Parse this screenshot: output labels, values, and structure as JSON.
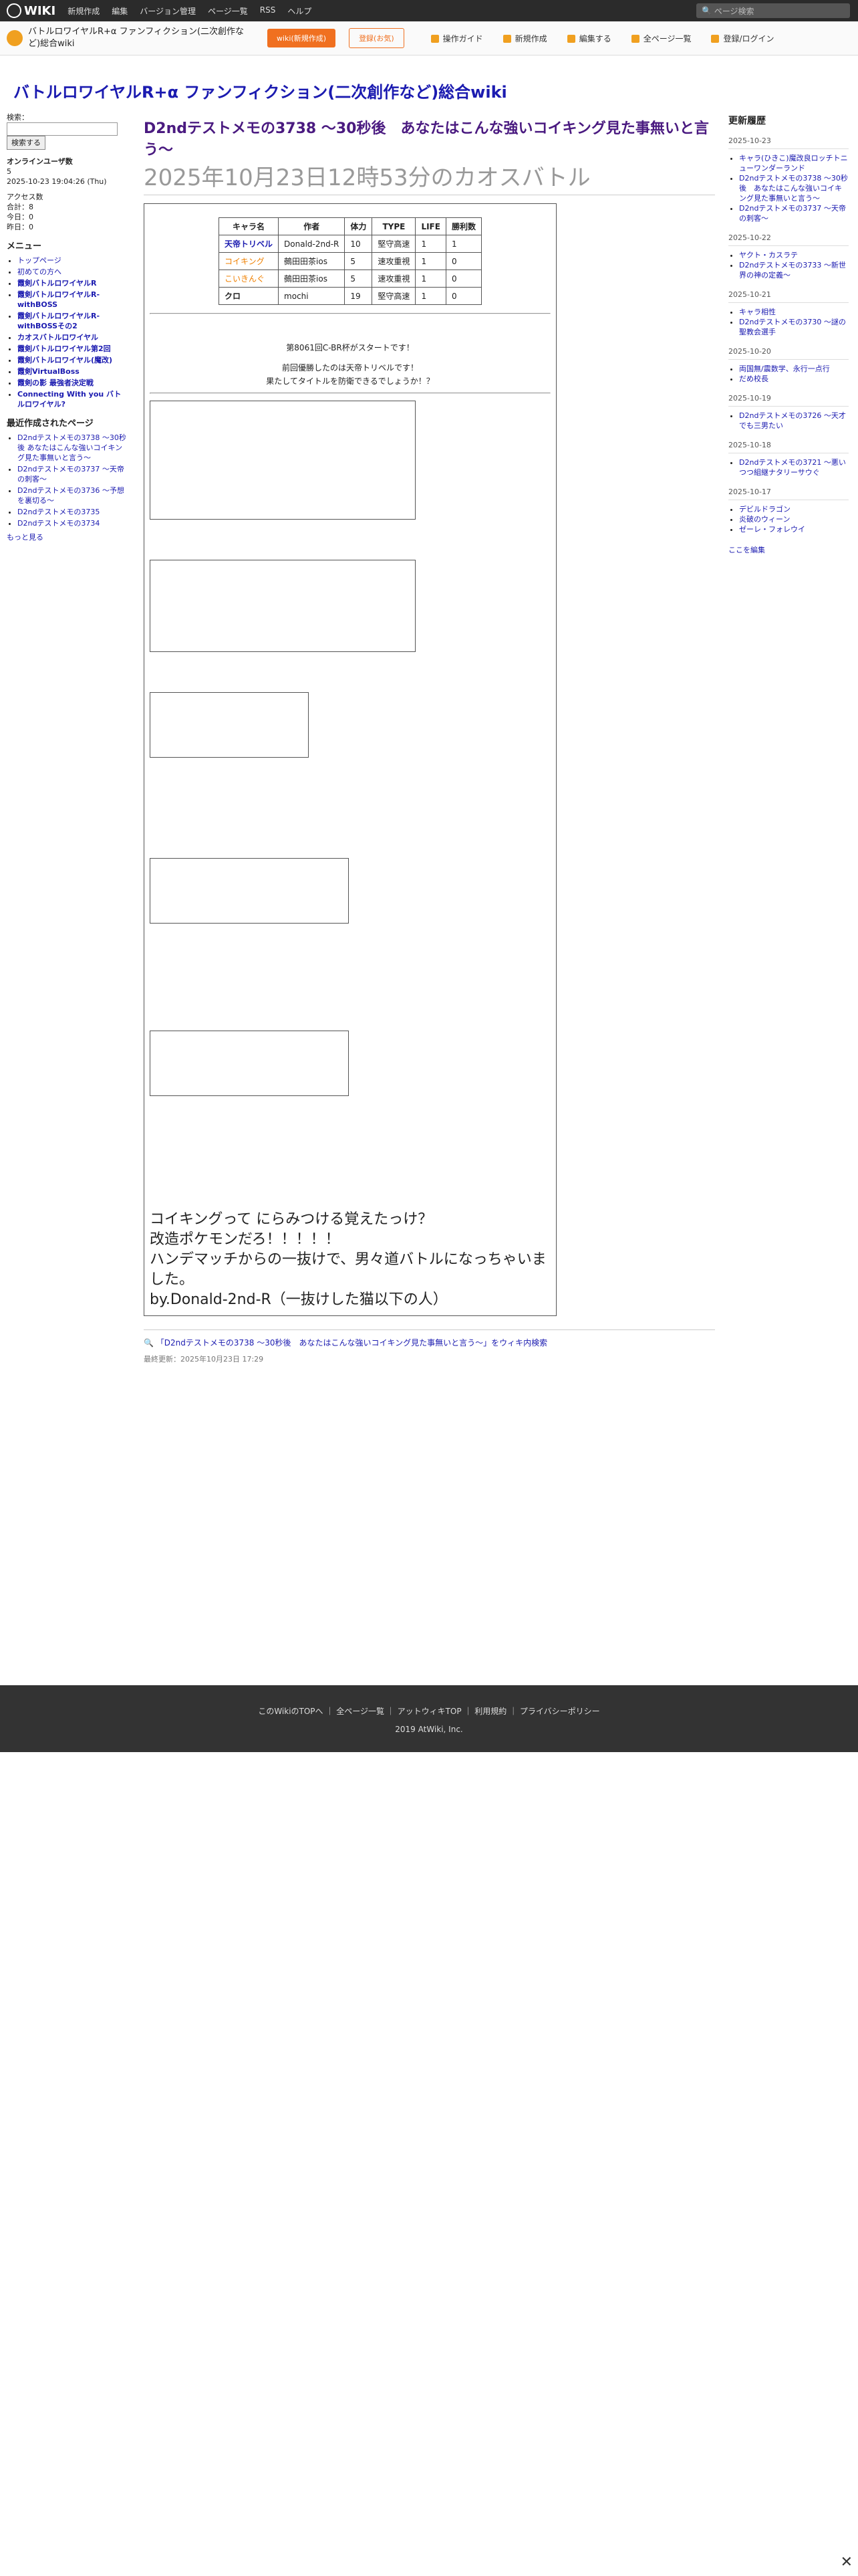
{
  "topbar": {
    "logo": "WIKI",
    "menu": [
      "新規作成",
      "編集",
      "バージョン管理",
      "ページ一覧",
      "RSS",
      "ヘルプ"
    ],
    "search_placeholder": "ページ検索"
  },
  "header": {
    "site_name": "バトルロワイヤルR+α ファンフィクション(二次創作など)総合wiki",
    "btn_wiki": "wiki(新規作成)",
    "btn_register": "登録(お気)",
    "nav": [
      "操作ガイド",
      "新規作成",
      "編集する",
      "全ページ一覧",
      "登録/ログイン"
    ]
  },
  "site_title": "バトルロワイヤルR+α ファンフィクション(二次創作など)総合wiki",
  "sidebar": {
    "search_label": "検索：",
    "search_btn": "検索する",
    "online_title": "オンラインユーザ数",
    "online_count": "5",
    "date": "2025-10-23 19:04:26 (Thu)",
    "access_title": "アクセス数",
    "access_total": "合計：8",
    "access_today": "今日：0",
    "access_yesterday": "昨日：0",
    "menu_title": "メニュー",
    "menu_items": [
      "トップページ",
      "初めての方へ",
      "霞剣バトルロワイヤルR",
      "霞剣バトルロワイヤルR-withBOSS",
      "霞剣バトルロワイヤルR-withBOSSその2",
      "カオスバトルロワイヤル",
      "霞剣バトルロワイヤル第2回",
      "霞剣バトルロワイヤル(魔改)",
      "霞剣VirtualBoss",
      "霞剣の影 最強者決定戦",
      "Connecting With you バトルロワイヤル?"
    ],
    "recent_title": "最近作成されたページ",
    "recent_items": [
      "D2ndテストメモの3738 ～30秒後 あなたはこんな強いコイキング見た事無いと言う～",
      "D2ndテストメモの3737 ～天帝の刺客～",
      "D2ndテストメモの3736 ～予想を裏切る～",
      "D2ndテストメモの3735",
      "D2ndテストメモの3734"
    ],
    "more": "もっと見る"
  },
  "main": {
    "title": "D2ndテストメモの3738 ～30秒後　あなたはこんな強いコイキング見た事無いと言う～",
    "subtitle": "2025年10月23日12時53分のカオスバトル",
    "table_headers": [
      "キャラ名",
      "作者",
      "体力",
      "TYPE",
      "LIFE",
      "勝利数"
    ],
    "table_rows": [
      [
        "天帝トリベル",
        "Donald-2nd-R",
        "10",
        "堅守高速",
        "1",
        "1"
      ],
      [
        "コイキング",
        "鵺田田茶ios",
        "5",
        "速攻重視",
        "1",
        "0"
      ],
      [
        "こいきんぐ",
        "鵺田田茶ios",
        "5",
        "速攻重視",
        "1",
        "0"
      ],
      [
        "クロ",
        "mochi",
        "19",
        "堅守高速",
        "1",
        "0"
      ]
    ],
    "start_text": "第8061回C-BR杯がスタートです！",
    "first_attacker": "前回優勝したのは天帝トリベルです！",
    "question": "果たしてタイトルを防衛できるでしょうか！？",
    "bigline1": "コイキングって にらみつける覚えたっけ？",
    "bigline2": "改造ポケモンだろ！！！！！",
    "bigline3": "ハンデマッチからの一抜けで、男々道バトルになっちゃいました。",
    "bigline4": "by.Donald-2nd-R（一抜けした猫以下の人）",
    "wiki_search": "「D2ndテストメモの3738 ～30秒後　あなたはこんな強いコイキング見た事無いと言う～」をウィキ内検索",
    "last_update": "最終更新：2025年10月23日 17:29"
  },
  "rightcol": {
    "title": "更新履歴",
    "dates": [
      {
        "date": "2025-10-23",
        "items": [
          "キャラ(ひきこ)魔改良ロッチトニューワンダーランド",
          "D2ndテストメモの3738 ～30秒後　あなたはこんな強いコイキング見た事無いと言う～",
          "D2ndテストメモの3737 ～天帝の刺客～"
        ]
      },
      {
        "date": "2025-10-22",
        "items": [
          "ヤクト・カスラテ",
          "D2ndテストメモの3733 ～新世界の神の定義～"
        ]
      },
      {
        "date": "2025-10-21",
        "items": [
          "キャラ相性",
          "D2ndテストメモの3730 ～謎の聖教会選手"
        ]
      },
      {
        "date": "2025-10-20",
        "items": [
          "両国無/震数学、永行一点行",
          "だめ校長"
        ]
      },
      {
        "date": "2025-10-19",
        "items": [
          "D2ndテストメモの3726 ～天才でも三男たい"
        ]
      },
      {
        "date": "2025-10-18",
        "items": [
          "D2ndテストメモの3721 ～悪いつつ組継ナタリーサウぐ"
        ]
      },
      {
        "date": "2025-10-17",
        "items": [
          "デビルドラゴン",
          "炎破のウィーン",
          "ゼーレ・フォレウイ"
        ]
      }
    ],
    "edit": "ここを編集"
  },
  "footer": {
    "links": [
      "このWikiのTOPへ",
      "全ページ一覧",
      "アットウィキTOP",
      "利用規約",
      "プライバシーポリシー"
    ],
    "copyright": "2019 AtWiki, Inc."
  }
}
